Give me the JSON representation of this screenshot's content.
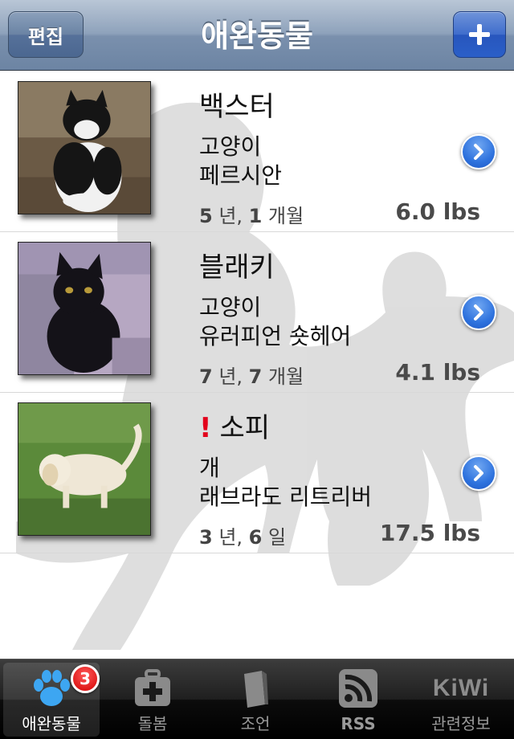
{
  "navbar": {
    "title": "애완동물",
    "edit_label": "편집",
    "add_icon": "plus-icon"
  },
  "pets": [
    {
      "name": "백스터",
      "alert": "",
      "species": "고양이",
      "breed": "페르시안",
      "age_num1": "5",
      "age_unit1": " 년, ",
      "age_num2": "1",
      "age_unit2": " 개월",
      "weight": "6.0 lbs",
      "photo": "black-and-white-cat-photo"
    },
    {
      "name": "블래키",
      "alert": "",
      "species": "고양이",
      "breed": "유러피언 숏헤어",
      "age_num1": "7",
      "age_unit1": " 년, ",
      "age_num2": "7",
      "age_unit2": " 개월",
      "weight": "4.1 lbs",
      "photo": "black-cat-photo"
    },
    {
      "name": "소피",
      "alert": "!",
      "species": "개",
      "breed": "래브라도 리트리버",
      "age_num1": "3",
      "age_unit1": " 년, ",
      "age_num2": "6",
      "age_unit2": " 일",
      "weight": "17.5 lbs",
      "photo": "white-dog-photo"
    }
  ],
  "tabbar": {
    "tabs": [
      {
        "label": "애완동물",
        "icon": "paw-icon",
        "badge": "3",
        "active": true
      },
      {
        "label": "돌봄",
        "icon": "medical-bag-icon"
      },
      {
        "label": "조언",
        "icon": "book-icon"
      },
      {
        "label": "RSS",
        "icon": "rss-icon"
      },
      {
        "label": "관련정보",
        "icon": "kiwi-icon",
        "icon_text": "KiWi"
      }
    ]
  },
  "colors": {
    "navbar": "#8ea2bb",
    "add_button": "#2a5fc8",
    "disclosure": "#2f73de",
    "alert": "#e3001b",
    "badge": "#d30000"
  }
}
